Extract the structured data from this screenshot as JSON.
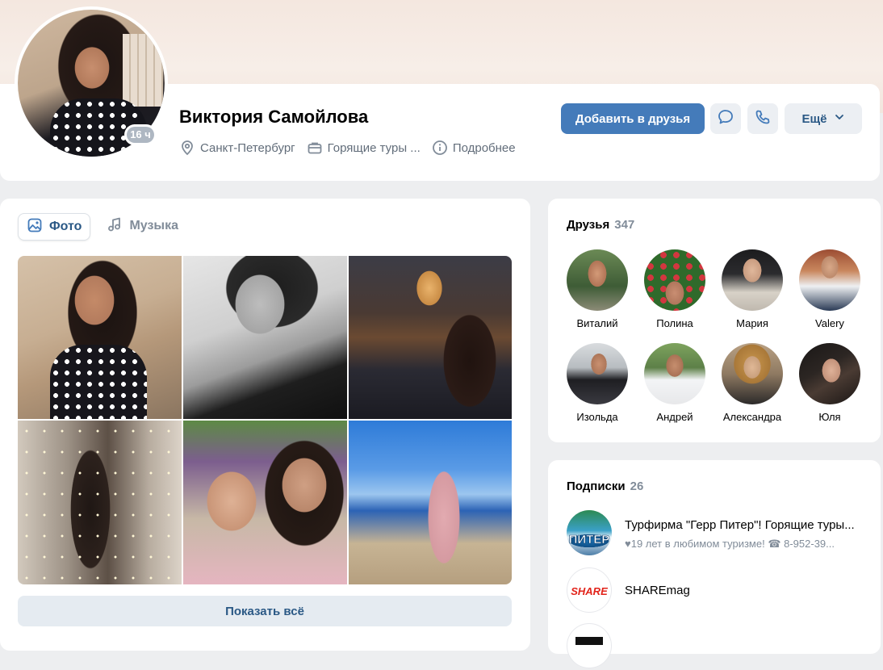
{
  "profile": {
    "name": "Виктория Самойлова",
    "online_badge": "16 ч",
    "city": "Санкт-Петербург",
    "job": "Горящие туры ...",
    "details": "Подробнее"
  },
  "actions": {
    "add_friend": "Добавить в друзья",
    "more": "Ещё"
  },
  "tabs": [
    {
      "label": "Фото",
      "active": true
    },
    {
      "label": "Музыка",
      "active": false
    }
  ],
  "photos": {
    "show_all": "Показать всё"
  },
  "friends": {
    "title": "Друзья",
    "count": "347",
    "items": [
      {
        "name": "Виталий"
      },
      {
        "name": "Полина"
      },
      {
        "name": "Мария"
      },
      {
        "name": "Valery"
      },
      {
        "name": "Изольда"
      },
      {
        "name": "Андрей"
      },
      {
        "name": "Александра"
      },
      {
        "name": "Юля"
      }
    ]
  },
  "subscriptions": {
    "title": "Подписки",
    "count": "26",
    "items": [
      {
        "title": "Турфирма \"Герр Питер\"! Горящие туры...",
        "desc": "♥19 лет в любимом туризме! ☎ 8-952-39..."
      },
      {
        "title": "SHAREmag",
        "desc": ""
      }
    ]
  },
  "colors": {
    "accent": "#447bba",
    "link": "#2a5885",
    "muted": "#818c99",
    "background": "#edeef0"
  }
}
